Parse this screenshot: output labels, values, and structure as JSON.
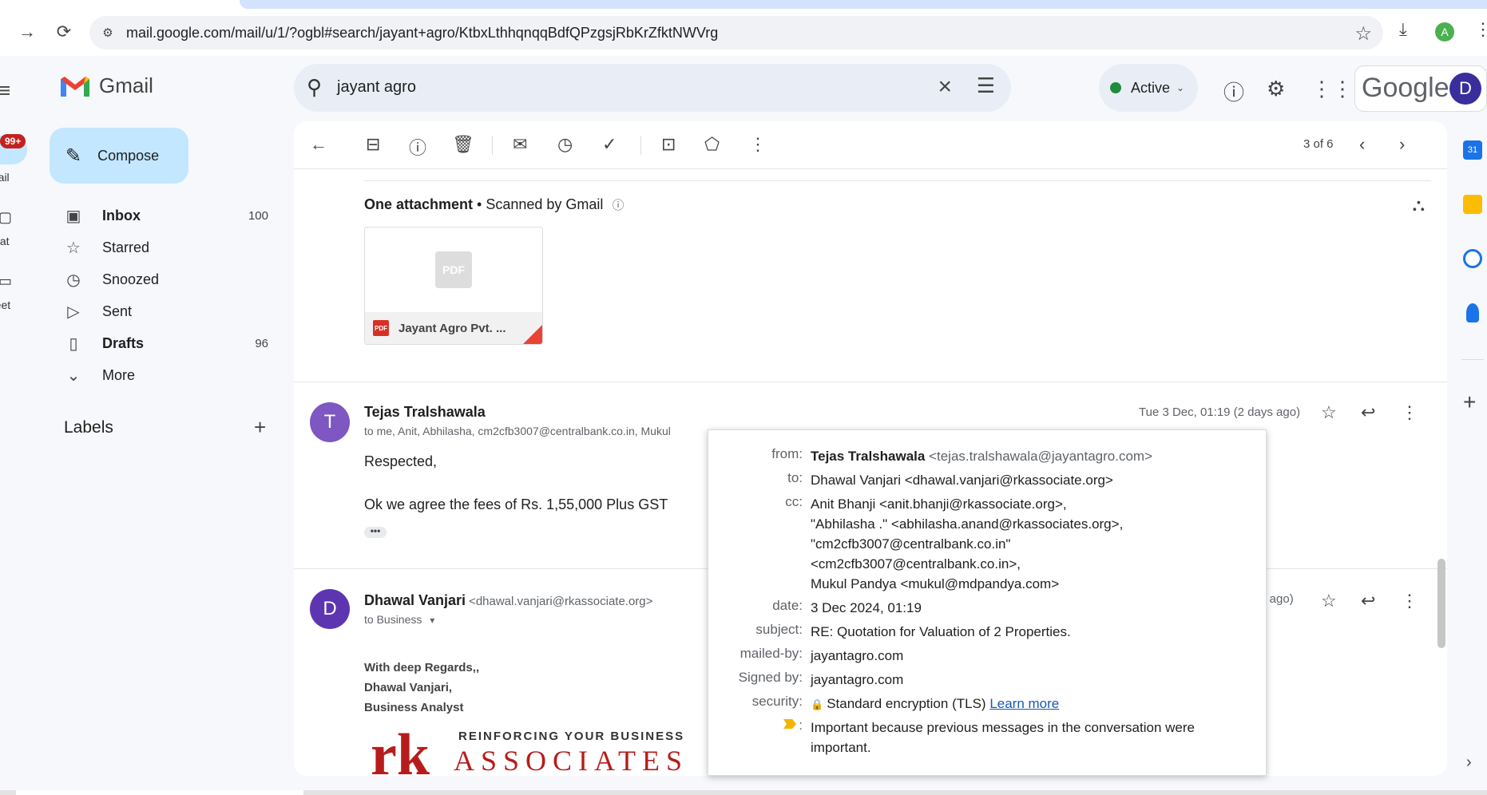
{
  "browser": {
    "url": "mail.google.com/mail/u/1/?ogbl#search/jayant+agro/KtbxLthhqnqqBdfQPzgsjRbKrZfktNWVrg",
    "profile_initial": "A"
  },
  "rail": {
    "badge": "99+",
    "mail_label": "Mail",
    "chat_label": "Chat",
    "meet_label": "Meet"
  },
  "header": {
    "app_name": "Gmail",
    "search_value": "jayant agro",
    "status": "Active",
    "google_text": "Google",
    "avatar_initial": "D"
  },
  "sidebar": {
    "compose_label": "Compose",
    "items": [
      {
        "label": "Inbox",
        "count": "100",
        "icon": "inbox-icon"
      },
      {
        "label": "Starred",
        "count": "",
        "icon": "star-icon"
      },
      {
        "label": "Snoozed",
        "count": "",
        "icon": "clock-icon"
      },
      {
        "label": "Sent",
        "count": "",
        "icon": "send-icon"
      },
      {
        "label": "Drafts",
        "count": "96",
        "icon": "draft-icon"
      },
      {
        "label": "More",
        "count": "",
        "icon": "chevron-down-icon"
      }
    ],
    "labels_title": "Labels"
  },
  "toolbar": {
    "pager": "3 of 6"
  },
  "attachment": {
    "title": "One attachment",
    "scanned": " • Scanned by Gmail",
    "file_name": "Jayant Agro Pvt. ...",
    "pdf_label": "PDF",
    "pdf_small": "PDF"
  },
  "messages": [
    {
      "avatar": "T",
      "avatar_color": "#7e57c2",
      "sender": "Tejas Tralshawala",
      "recipients": "to me, Anit, Abhilasha, cm2cfb3007@centralbank.co.in, Mukul",
      "date": "Tue 3 Dec, 01:19 (2 days ago)",
      "body_1": "Respected,",
      "body_2": "Ok we agree the fees of Rs. 1,55,000 Plus GST",
      "ellipsis": "•••"
    },
    {
      "avatar": "D",
      "avatar_color": "#5e35b1",
      "sender": "Dhawal Vanjari",
      "sender_email": "<dhawal.vanjari@rkassociate.org>",
      "recipients": "to Business",
      "date_partial": "s ago)",
      "sig_1": "With deep Regards,,",
      "sig_2": "Dhawal Vanjari,",
      "sig_3": "Business Analyst",
      "logo_tagline": "REINFORCING YOUR BUSINESS",
      "logo_name": "ASSOCIATES",
      "logo_mark": "rk"
    }
  ],
  "details": {
    "from_label": "from:",
    "from_name": "Tejas Tralshawala",
    "from_email": "<tejas.tralshawala@jayantagro.com>",
    "to_label": "to:",
    "to_value": "Dhawal Vanjari <dhawal.vanjari@rkassociate.org>",
    "cc_label": "cc:",
    "cc_lines": [
      "Anit Bhanji <anit.bhanji@rkassociate.org>,",
      "\"Abhilasha .\" <abhilasha.anand@rkassociates.org>,",
      "\"cm2cfb3007@centralbank.co.in\"",
      "<cm2cfb3007@centralbank.co.in>,",
      "Mukul Pandya <mukul@mdpandya.com>"
    ],
    "date_label": "date:",
    "date_value": "3 Dec 2024, 01:19",
    "subject_label": "subject:",
    "subject_value": "RE: Quotation for Valuation of 2 Properties.",
    "mailed_by_label": "mailed-by:",
    "mailed_by_value": "jayantagro.com",
    "signed_by_label": "Signed by:",
    "signed_by_value": "jayantagro.com",
    "security_label": "security:",
    "security_value": "Standard encryption (TLS)",
    "learn_more": "Learn more",
    "importance_colon": ":",
    "importance_line_1": "Important because previous messages in the conversation were",
    "importance_line_2": "important."
  },
  "side_panel": {
    "calendar_day": "31"
  }
}
